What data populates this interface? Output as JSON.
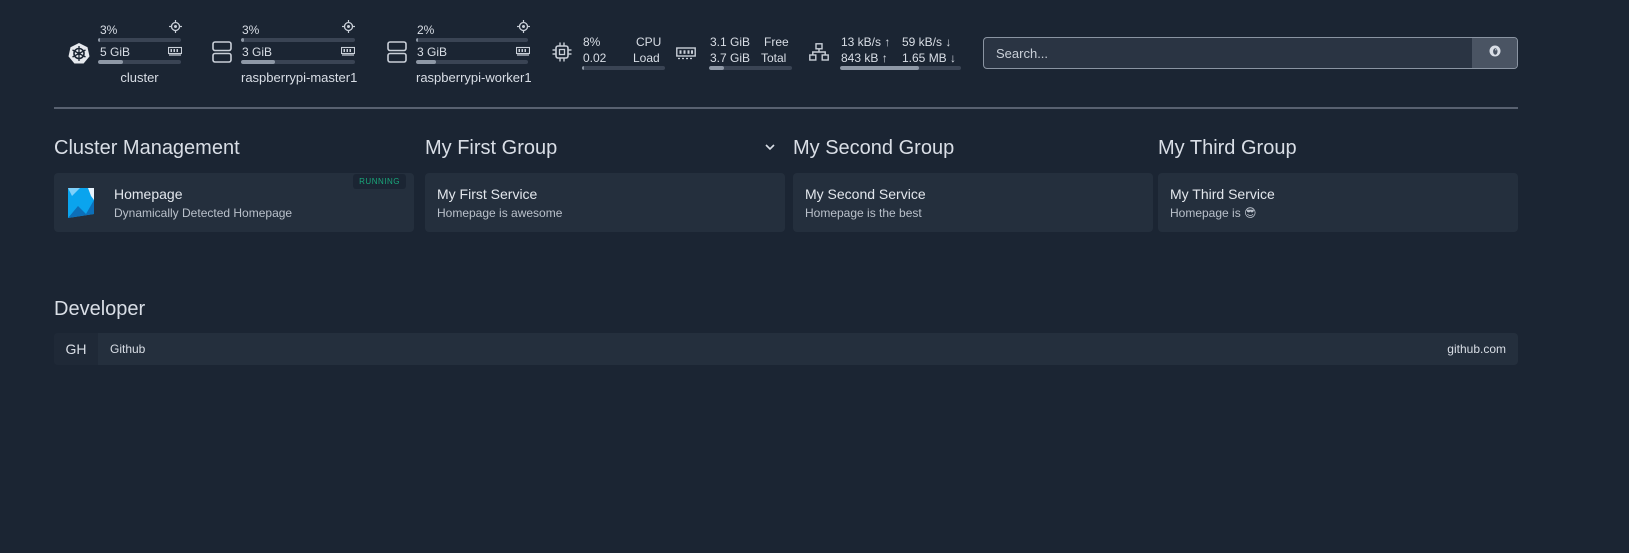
{
  "widgets": {
    "kubernetes": [
      {
        "cpu": "3%",
        "cpu_fraction": 0.03,
        "memory": "5 GiB",
        "memory_fraction": 0.3,
        "label": "cluster",
        "icon": "kubernetes-icon"
      },
      {
        "cpu": "3%",
        "cpu_fraction": 0.03,
        "memory": "3 GiB",
        "memory_fraction": 0.3,
        "label": "raspberrypi-master1",
        "icon": "server-icon"
      },
      {
        "cpu": "2%",
        "cpu_fraction": 0.02,
        "memory": "3 GiB",
        "memory_fraction": 0.18,
        "label": "raspberrypi-worker1",
        "icon": "server-icon"
      }
    ],
    "cpu": {
      "percent": "8%",
      "load": "0.02",
      "label_cpu": "CPU",
      "label_load": "Load",
      "fraction": 0.03
    },
    "memory": {
      "free": "3.1 GiB",
      "total": "3.7 GiB",
      "label_free": "Free",
      "label_total": "Total",
      "fraction": 0.18
    },
    "network": {
      "up_rate": "13 kB/s ↑",
      "down_rate": "59 kB/s ↓",
      "up_total": "843 kB ↑",
      "down_total": "1.65 MB ↓",
      "fraction": 0.65
    }
  },
  "search": {
    "placeholder": "Search..."
  },
  "groups": [
    {
      "title": "Cluster Management",
      "services": [
        {
          "name": "Homepage",
          "description": "Dynamically Detected Homepage",
          "status": "RUNNING"
        }
      ]
    },
    {
      "title": "My First Group",
      "services": [
        {
          "name": "My First Service",
          "description": "Homepage is awesome"
        }
      ]
    },
    {
      "title": "My Second Group",
      "services": [
        {
          "name": "My Second Service",
          "description": "Homepage is the best"
        }
      ]
    },
    {
      "title": "My Third Group",
      "services": [
        {
          "name": "My Third Service",
          "description": "Homepage is 😎"
        }
      ]
    }
  ],
  "bookmarks": {
    "title": "Developer",
    "items": [
      {
        "abbr": "GH",
        "name": "Github",
        "href": "github.com"
      }
    ]
  },
  "colors": {
    "background": "#1b2533",
    "card": "#242f3d",
    "running": "#19a87b",
    "homepage_logo": "#0aa4ee"
  }
}
